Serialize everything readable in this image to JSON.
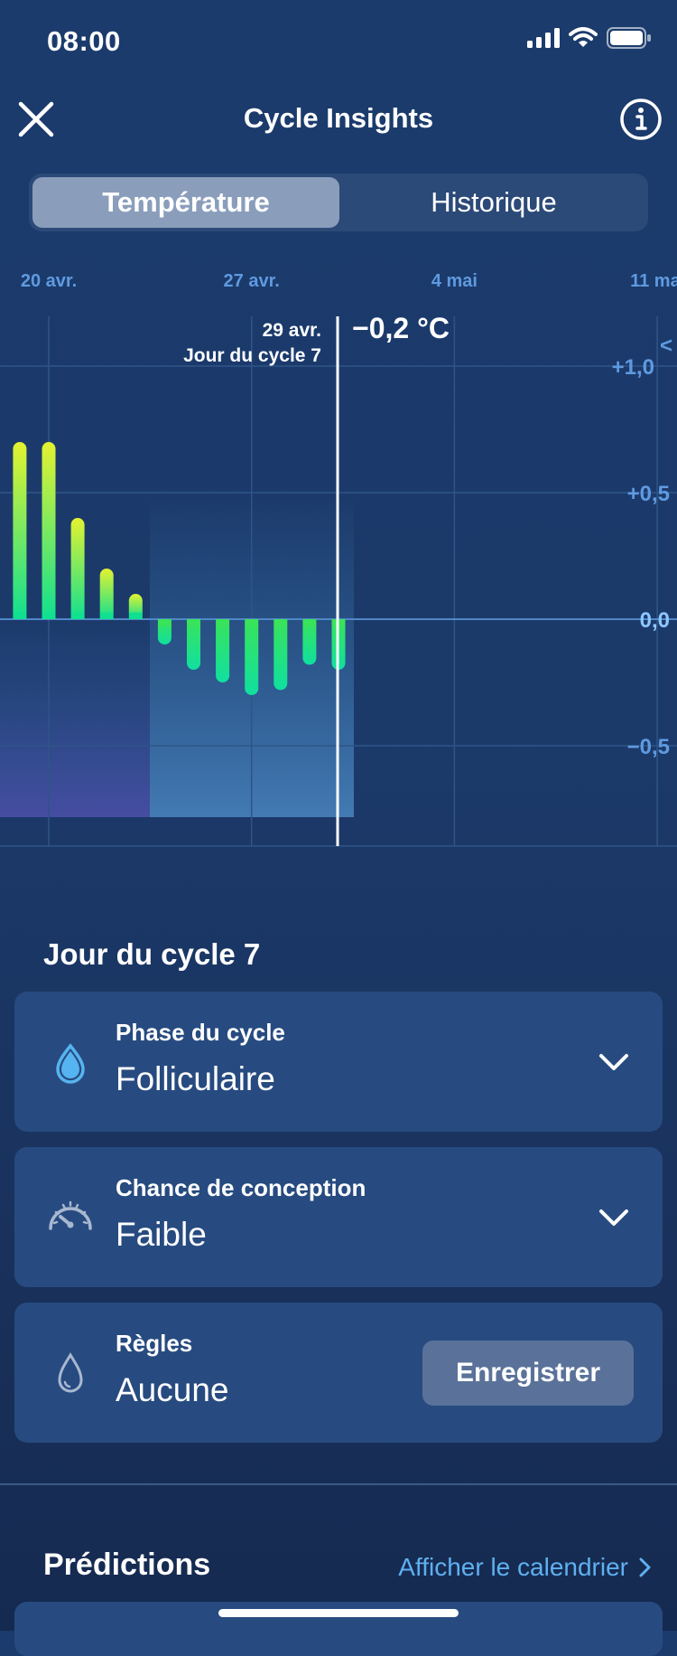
{
  "status": {
    "time": "08:00"
  },
  "header": {
    "title": "Cycle Insights"
  },
  "tabs": [
    {
      "label": "Température",
      "active": true
    },
    {
      "label": "Historique",
      "active": false
    }
  ],
  "chart_data": {
    "type": "bar",
    "x_ticks": [
      "20 avr.",
      "27 avr.",
      "4 mai",
      "11 ma"
    ],
    "y_ticks": [
      "+1,0",
      "+0,5",
      "0,0",
      "−0,5"
    ],
    "y_tick_values": [
      1.0,
      0.5,
      0.0,
      -0.5
    ],
    "ylim": [
      -0.9,
      1.2
    ],
    "day_index_start": "20 avr.",
    "bars": [
      0.7,
      0.7,
      0.4,
      0.2,
      0.1,
      -0.1,
      -0.2,
      -0.25,
      -0.3,
      -0.28,
      -0.18,
      -0.2
    ],
    "bar_start_offset_days": -1,
    "selected": {
      "date": "29 avr.",
      "cycle_day": "Jour du cycle 7",
      "value": "−0,2 °C",
      "offset_days": 11
    },
    "period_days": 3,
    "period_start_offset_days": 4,
    "colors": {
      "top": "#e4f230",
      "bottom": "#10e090"
    }
  },
  "cycle_day_title": "Jour du cycle 7",
  "cards": {
    "phase": {
      "label": "Phase du cycle",
      "value": "Folliculaire",
      "icon": "drop-filled-icon"
    },
    "conception": {
      "label": "Chance de conception",
      "value": "Faible",
      "icon": "gauge-icon"
    },
    "period": {
      "label": "Règles",
      "value": "Aucune",
      "icon": "drop-outline-icon",
      "button": "Enregistrer"
    }
  },
  "predictions": {
    "title": "Prédictions",
    "link": "Afficher le calendrier"
  },
  "colors": {
    "accent": "#5fb0f0",
    "card": "#274b80",
    "axis": "#5f9ae0"
  }
}
